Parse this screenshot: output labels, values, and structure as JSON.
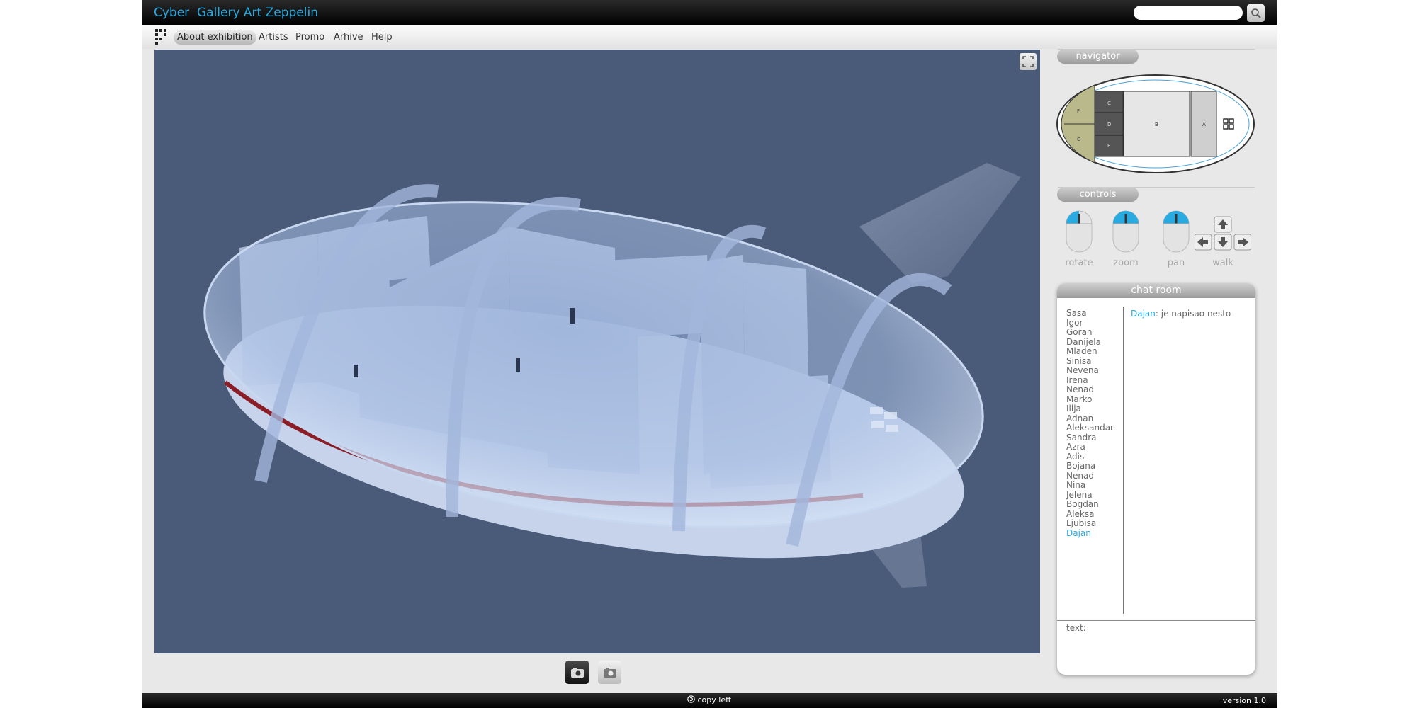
{
  "header": {
    "title": "Cyber  Gallery Art Zeppelin",
    "search_placeholder": "",
    "search_icon": "magnifier-icon"
  },
  "menu": {
    "items": [
      "About exhibition",
      "Artists",
      "Promo",
      "Arhive",
      "Help"
    ],
    "active": "About exhibition"
  },
  "navigator": {
    "title": "navigator",
    "rooms": [
      "F",
      "G",
      "C",
      "D",
      "E",
      "B",
      "A"
    ]
  },
  "controls": {
    "title": "controls",
    "items": [
      "rotate",
      "zoom",
      "pan",
      "walk"
    ]
  },
  "chat": {
    "title": "chat room",
    "users": [
      "Sasa",
      "Igor",
      "Goran",
      "Danijela",
      "Mladen",
      "Sinisa",
      "Nevena",
      "Irena",
      "Nenad",
      "Marko",
      "Ilija",
      "Adnan",
      "Aleksandar",
      "Sandra",
      "Azra",
      "Adis",
      "Bojana",
      "Nenad",
      "Nina",
      "Jelena",
      "Bogdan",
      "Aleksa",
      "Ljubisa",
      "Dajan"
    ],
    "highlighted_user": "Dajan",
    "message_author": "Dajan",
    "message_text": ": je napisao nesto",
    "input_label": "text:"
  },
  "footer": {
    "copyleft": "copy left",
    "version": "version 1.0"
  },
  "colors": {
    "accent": "#29abe2",
    "viewport_bg": "#4a5a79",
    "navigator_zone": "#b9b98c"
  }
}
